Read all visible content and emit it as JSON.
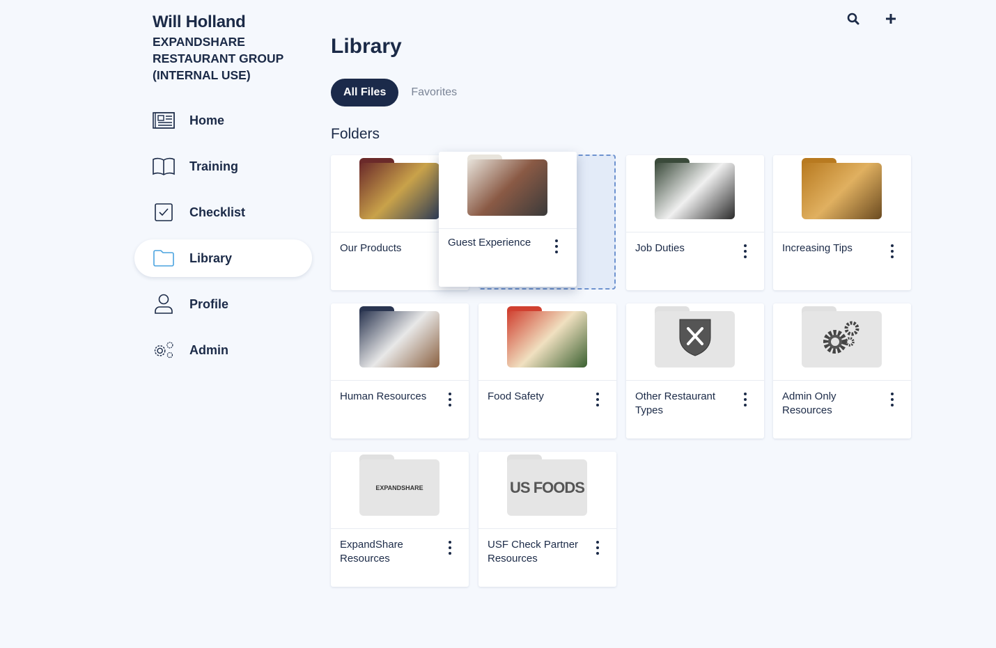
{
  "user": {
    "name": "Will Holland",
    "org": "EXPANDSHARE RESTAURANT GROUP (INTERNAL USE)"
  },
  "nav": [
    {
      "label": "Home",
      "icon": "newspaper-icon"
    },
    {
      "label": "Training",
      "icon": "book-icon"
    },
    {
      "label": "Checklist",
      "icon": "checkbox-icon"
    },
    {
      "label": "Library",
      "icon": "folder-icon",
      "active": true
    },
    {
      "label": "Profile",
      "icon": "user-icon"
    },
    {
      "label": "Admin",
      "icon": "gears-icon"
    }
  ],
  "header": {
    "title": "Library",
    "search_icon": "search-icon",
    "add_icon": "plus-icon"
  },
  "tabs": [
    {
      "label": "All Files",
      "active": true
    },
    {
      "label": "Favorites"
    }
  ],
  "section_title": "Folders",
  "folders": [
    {
      "title": "Our Products",
      "thumb": "photo",
      "colors": [
        "#6b2a2a",
        "#c9a24a",
        "#2d3b55"
      ]
    },
    {
      "title": "Guest Experience",
      "thumb": "photo",
      "colors": [
        "#e8e4dc",
        "#8a5a45",
        "#3a3a3a"
      ],
      "dragging": true
    },
    {
      "title": "Job Duties",
      "thumb": "photo",
      "colors": [
        "#3a4a3a",
        "#f0f0f0",
        "#2a2a2a"
      ]
    },
    {
      "title": "Increasing Tips",
      "thumb": "photo",
      "colors": [
        "#b87a20",
        "#e0b060",
        "#6a4a20"
      ]
    },
    {
      "title": "Human Resources",
      "thumb": "photo",
      "colors": [
        "#2a3550",
        "#e8e8e8",
        "#8a6040"
      ]
    },
    {
      "title": "Food Safety",
      "thumb": "photo",
      "colors": [
        "#d04030",
        "#f0e0c0",
        "#3a6030"
      ]
    },
    {
      "title": "Other Restaurant Types",
      "thumb": "icon",
      "icon": "utensils-shield-icon"
    },
    {
      "title": "Admin Only Resources",
      "thumb": "icon",
      "icon": "gears-icon"
    },
    {
      "title": "ExpandShare Resources",
      "thumb": "logo",
      "logo": "EXPANDSHARE"
    },
    {
      "title": "USF Check Partner Resources",
      "thumb": "logo",
      "logo": "US FOODS"
    }
  ],
  "colors": {
    "accent": "#1b2a4a",
    "active_icon": "#4aa3df",
    "placeholder": "#6d92cf"
  }
}
